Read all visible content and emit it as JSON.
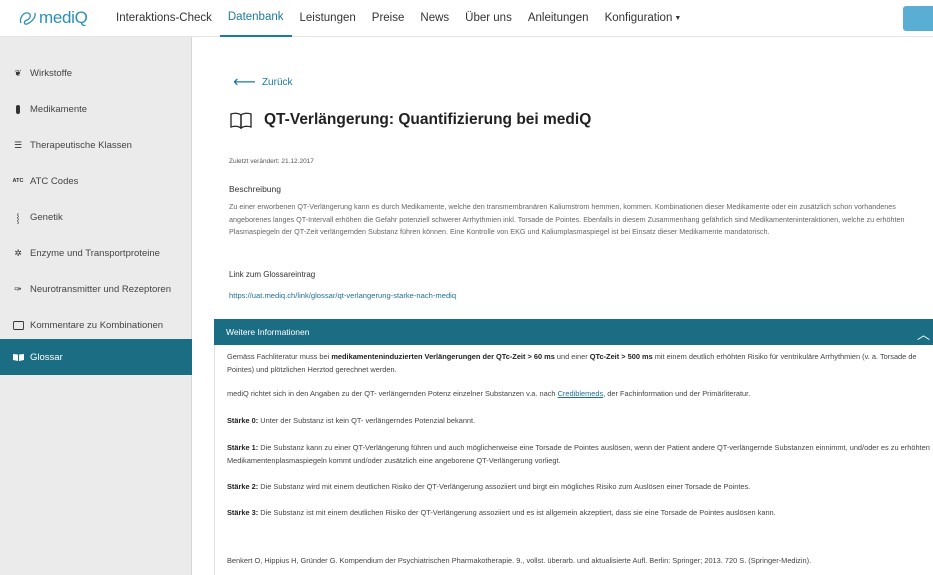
{
  "header": {
    "logo_text": "mediQ",
    "nav": [
      {
        "label": "Interaktions-Check"
      },
      {
        "label": "Datenbank"
      },
      {
        "label": "Leistungen"
      },
      {
        "label": "Preise"
      },
      {
        "label": "News"
      },
      {
        "label": "Über uns"
      },
      {
        "label": "Anleitungen"
      },
      {
        "label": "Konfiguration"
      }
    ],
    "active_nav": "Datenbank"
  },
  "sidebar": {
    "items": [
      {
        "label": "Wirkstoffe",
        "icon": "substance-icon"
      },
      {
        "label": "Medikamente",
        "icon": "pill-icon"
      },
      {
        "label": "Therapeutische Klassen",
        "icon": "list-icon"
      },
      {
        "label": "ATC Codes",
        "icon": "atc-icon",
        "icon_text": "ATC"
      },
      {
        "label": "Genetik",
        "icon": "dna-icon"
      },
      {
        "label": "Enzyme und Transportproteine",
        "icon": "enzyme-icon"
      },
      {
        "label": "Neurotransmitter und Rezeptoren",
        "icon": "neuron-icon"
      },
      {
        "label": "Kommentare zu Kombinationen",
        "icon": "comment-icon"
      },
      {
        "label": "Glossar",
        "icon": "book-icon"
      }
    ],
    "active": "Glossar"
  },
  "main": {
    "back_label": "Zurück",
    "title": "QT-Verlängerung: Quantifizierung bei mediQ",
    "updated": "Zuletzt verändert: 21.12.2017",
    "description_label": "Beschreibung",
    "description": "Zu einer erworbenen QT-Verlängerung kann es durch Medikamente, welche den transmembranären Kaliumstrom hemmen, kommen. Kombinationen dieser Medikamente oder ein zusätzlich schon vorhandenes angeborenes langes QT-Intervall erhöhen die Gefahr potenziell schwerer Arrhythmien inkl. Torsade de Pointes. Ebenfalls in diesem Zusammenhang gefährlich sind Medikamenteninteraktionen, welche zu erhöhten Plasmaspiegeln der QT-Zeit verlängernden Substanz führen können. Eine Kontrolle von EKG und Kaliumplasmaspiegel ist bei Einsatz dieser Medikamente mandatorisch.",
    "link_label": "Link zum Glossareintrag",
    "link_url": "https://uat.mediq.ch/link/glossar/qt-verlangerung-starke-nach-mediq"
  },
  "panel": {
    "header": "Weitere Informationen",
    "p1_a": "Gemäss Fachliteratur muss bei ",
    "p1_b": "medikamenteninduzierten Verlängerungen der QTc-Zeit > 60 ms",
    "p1_c": " und einer ",
    "p1_d": "QTc-Zeit > 500 ms",
    "p1_e": " mit einem deutlich erhöhten Risiko für ventrikuläre Arrhythmien (v. a. Torsade de Pointes) und plötzlichen Herztod gerechnet werden.",
    "p2_a": "mediQ richtet sich in den Angaben zu der QT- verlängernden Potenz einzelner Substanzen v.a. nach ",
    "p2_link": "Crediblemeds",
    "p2_c": ", der Fachinformation und der Primärliteratur.",
    "s0_label": "Stärke 0:",
    "s0_text": " Unter der Substanz ist kein QT- verlängerndes Potenzial bekannt.",
    "s1_label": "Stärke 1:",
    "s1_text": " Die Substanz kann zu einer QT-Verlängerung führen und auch möglicherweise eine Torsade de Pointes auslösen, wenn der Patient andere QT-verlängernde Substanzen einnimmt, und/oder es zu erhöhten Medikamentenplasmaspiegeln kommt und/oder zusätzlich eine angeborene QT-Verlängerung vorliegt.",
    "s2_label": "Stärke 2:",
    "s2_text": " Die Substanz wird mit einem deutlichen Risiko der QT-Verlängerung assoziiert und birgt ein mögliches Risiko zum Auslösen einer Torsade de Pointes.",
    "s3_label": "Stärke 3:",
    "s3_text": " Die Substanz ist mit einem deutlichen Risiko der QT-Verlängerung assoziiert und es ist allgemein akzeptiert, dass sie eine Torsade de Pointes auslösen kann.",
    "reference": "Benkert O, Hippius H, Gründer G. Kompendium der Psychiatrischen Pharmakotherapie. 9., vollst. überarb. und aktualisierte Aufl. Berlin: Springer; 2013. 720 S. (Springer-Medizin)."
  },
  "colors": {
    "accent": "#1b6d84",
    "link": "#1d6f98",
    "sidebar_bg": "#ebebeb"
  }
}
